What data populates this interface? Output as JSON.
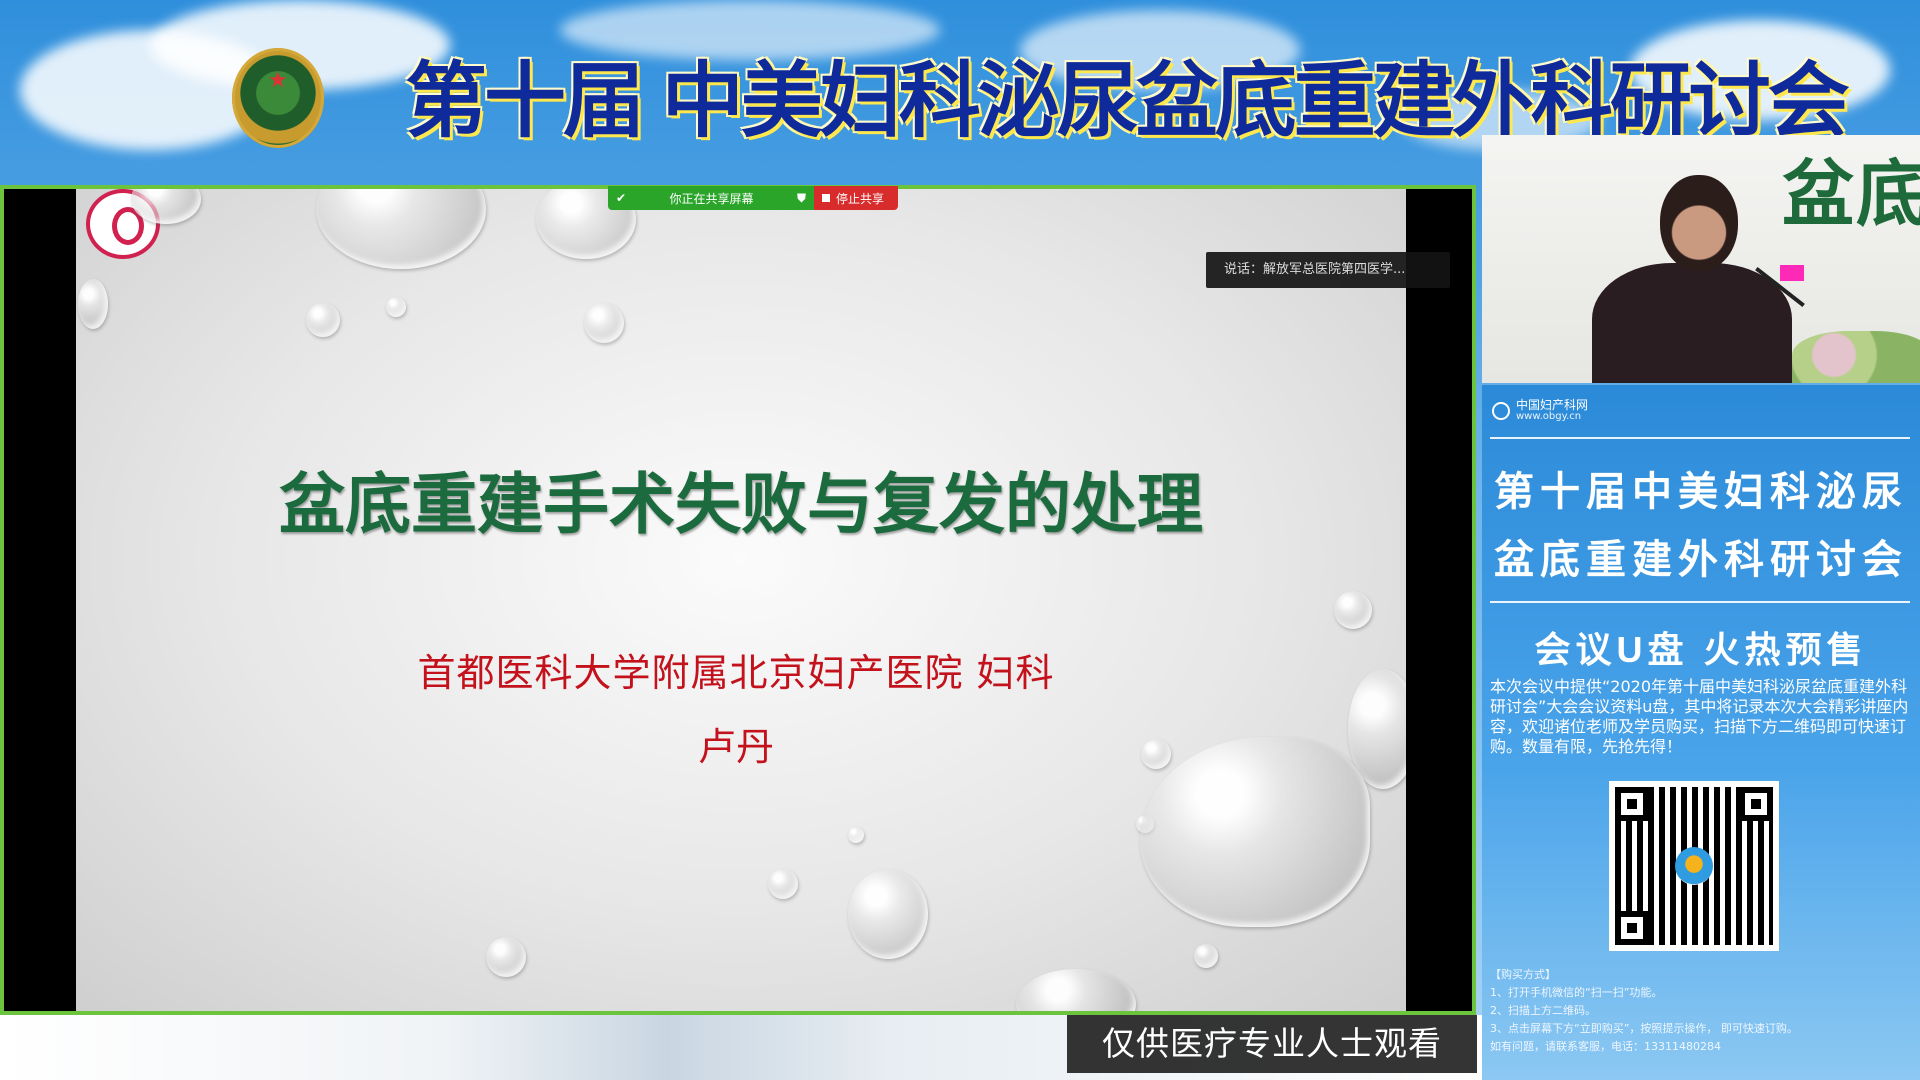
{
  "header": {
    "conference_title": "第十届 中美妇科泌尿盆底重建外科研讨会"
  },
  "share_bar": {
    "status_text": "你正在共享屏幕",
    "stop_label": "停止共享"
  },
  "speaking_indicator": "说话：解放军总医院第四医学...",
  "slide": {
    "title": "盆底重建手术失败与复发的处理",
    "affiliation": "首都医科大学附属北京妇产医院 妇科",
    "presenter": "卢丹"
  },
  "camera": {
    "banner_text": "盆底"
  },
  "ad_panel": {
    "brand_name": "中国妇产科网",
    "brand_url": "www.obgy.cn",
    "title_line1": "第十届中美妇科泌尿",
    "title_line2": "盆底重建外科研讨会",
    "promo": "会议U盘  火热预售",
    "description": "本次会议中提供“2020年第十届中美妇科泌尿盆底重建外科研讨会”大会会议资料u盘，其中将记录本次大会精彩讲座内容，欢迎诸位老师及学员购买，扫描下方二维码即可快速订购。数量有限，先抢先得！",
    "purchase_heading": "【购买方式】",
    "purchase_step1": "1、打开手机微信的“扫一扫”功能。",
    "purchase_step2": "2、扫描上方二维码。",
    "purchase_step3": "3、点击屏幕下方“立即购买”，按照提示操作，      即可快速订购。",
    "contact": "如有问题，请联系客服，电话：13311480284"
  },
  "footer_notice": "仅供医疗专业人士观看",
  "colors": {
    "title_blue": "#0f2a9a",
    "slide_title_green": "#1b6b3e",
    "slide_text_red": "#c3121c",
    "share_green": "#2aa52a",
    "stop_red": "#d82b2b",
    "frame_green": "#6cc43e"
  }
}
